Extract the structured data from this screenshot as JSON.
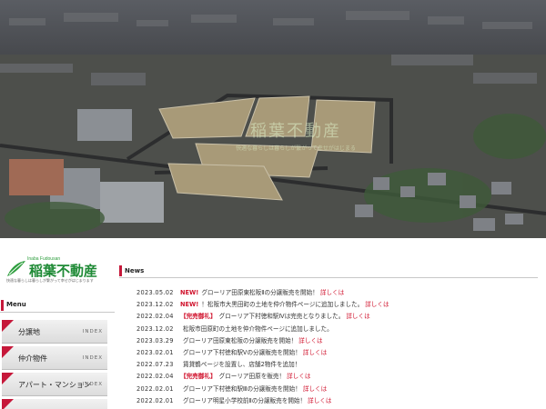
{
  "hero": {
    "overlay_logo_text": "稲葉不動産",
    "overlay_tagline": "快適な暮らしは暮らしが繋がって幸せがはじまる"
  },
  "brand": {
    "romaji": "Inaba Fudousan",
    "name": "稲葉不動産",
    "tagline": "快適な暮らしは暮らしが繋がって幸せがはじまります",
    "color": "#1f8a36"
  },
  "menu": {
    "title": "Menu",
    "items": [
      {
        "label": "分譲地",
        "en": "INDEX"
      },
      {
        "label": "仲介物件",
        "en": "INDEX"
      },
      {
        "label": "アパート・マンション",
        "en": "INDEX"
      },
      {
        "label": "",
        "en": ""
      }
    ]
  },
  "news": {
    "title": "News",
    "accent": "#c6183a",
    "items": [
      {
        "date": "2023.05.02",
        "badge": "NEW!",
        "text": "グローリア田原東松阪Ⅱの分譲販売を開始！",
        "more": "詳しくは"
      },
      {
        "date": "2023.12.02",
        "badge": "NEW!",
        "text": "！松阪市大黒田町の土地を仲介物件ページに追加しました。",
        "more": "詳しくは"
      },
      {
        "date": "2022.02.04",
        "badge": "【完売御礼】",
        "text": "グローリア下村徳和駅Ⅳは完売となりました。",
        "more": "詳しくは"
      },
      {
        "date": "2023.12.02",
        "badge": "",
        "text": "松阪市田原町の土地を仲介物件ページに追加しました。",
        "more": ""
      },
      {
        "date": "2023.03.29",
        "badge": "",
        "text": "グローリア田原東松阪の分譲販売を開始！",
        "more": "詳しくは"
      },
      {
        "date": "2023.02.01",
        "badge": "",
        "text": "グローリア下村徳和駅Ⅴの分譲販売を開始！",
        "more": "詳しくは"
      },
      {
        "date": "2022.07.23",
        "badge": "",
        "text": "賃貸鶴ページを設置し、店舗2物件を追加！",
        "more": ""
      },
      {
        "date": "2022.02.04",
        "badge": "【完売御礼】",
        "text": "グローリア田原を販売！",
        "more": "詳しくは"
      },
      {
        "date": "2022.02.01",
        "badge": "",
        "text": "グローリア下村徳和駅Ⅲの分譲販売を開始！",
        "more": "詳しくは"
      },
      {
        "date": "2022.02.01",
        "badge": "",
        "text": "グローリア明星小学校前Ⅱの分譲販売を開始！",
        "more": "詳しくは"
      }
    ]
  }
}
